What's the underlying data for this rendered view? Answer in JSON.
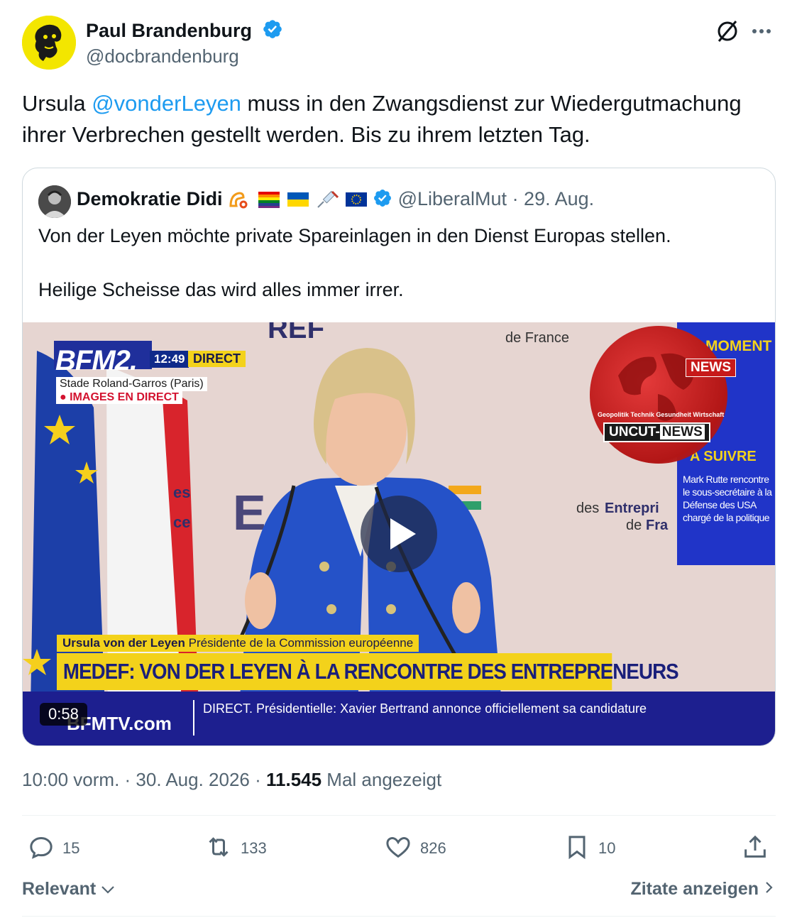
{
  "tweet": {
    "author_name": "Paul Brandenburg",
    "author_handle": "@docbrandenburg",
    "text_before_mention": "Ursula ",
    "mention": "@vonderLeyen",
    "text_after_mention": " muss in den Zwangsdienst zur Wiedergutmachung ihrer Verbrechen gestellt werden. Bis zu ihrem letzten Tag.",
    "timestamp": "10:00 vorm. · 30. Aug. 2026 · ",
    "views_count": "11.545",
    "views_label": " Mal angezeigt"
  },
  "quoted": {
    "author_name": "Demokratie Didi",
    "author_handle": "@LiberalMut",
    "date": "· 29. Aug.",
    "text_line1": "Von der Leyen möchte private Spareinlagen in den Dienst Europas stellen.",
    "text_line2": "Heilige Scheisse das wird alles immer irrer.",
    "emoji_icons": [
      "horn-emoji",
      "rainbow-flag-emoji",
      "ukraine-flag-emoji",
      "syringe-emoji",
      "eu-flag-emoji"
    ]
  },
  "video": {
    "duration": "0:58",
    "bfm_logo": "BFM2.",
    "bfm_time": "12:49",
    "bfm_direct": "DIRECT",
    "location": "Stade Roland-Garros (Paris)",
    "live_label": "● IMAGES EN DIRECT",
    "side_title": "MOMENT",
    "side_suivre": "A SUIVRE",
    "side_text": "Mark Rutte rencontre le sous-secrétaire à la Défense des USA chargé de la politique",
    "news_tag": "NEWS",
    "uncut_sub": "Geopolitik Technik Gesundheit Wirtschaft",
    "uncut_part1": "UNCUT-",
    "uncut_part2": "NEWS",
    "lower_name_bold": "Ursula von der Leyen",
    "lower_name_rest": " Présidente de la Commission européenne",
    "headline": "MEDEF: VON DER LEYEN À LA RENCONTRE DES ENTREPRENEURS",
    "ticker_brand": "BFMTV.com",
    "ticker_text": "DIRECT. Présidentielle: Xavier Bertrand annonce officiellement sa candidature",
    "backdrop_text1": "des Entreprises",
    "backdrop_text2": "de France"
  },
  "actions": {
    "replies": "15",
    "retweets": "133",
    "likes": "826",
    "bookmarks": "10"
  },
  "footer": {
    "relevant": "Relevant",
    "quotes_link": "Zitate anzeigen"
  },
  "colors": {
    "accent": "#1d9bf0",
    "secondary_text": "#536471",
    "bfm_yellow": "#f3d21b",
    "bfm_blue": "#1d1f8f"
  }
}
